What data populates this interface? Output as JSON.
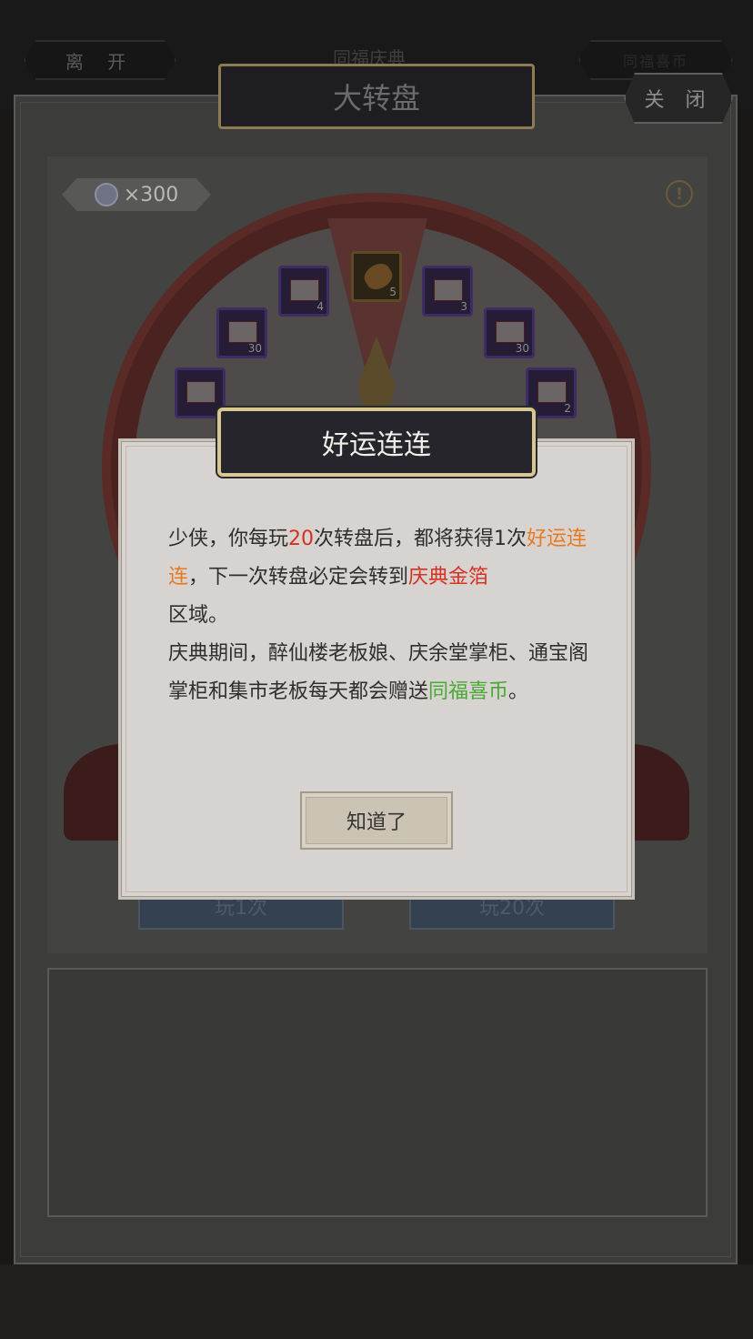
{
  "topbar": {
    "leave_label": "离 开",
    "event_title": "同福庆典",
    "right_label": "同福喜币"
  },
  "header": {
    "title": "大转盘",
    "close_label": "关 闭"
  },
  "wheel": {
    "coin_count": "×300",
    "info_symbol": "!",
    "prizes": [
      {
        "count": "4"
      },
      {
        "count": "5"
      },
      {
        "count": "3"
      },
      {
        "count": "30"
      },
      {
        "count": "30"
      },
      {
        "count": ""
      },
      {
        "count": "2"
      }
    ],
    "play_once_label": "玩1次",
    "play_twenty_label": "玩20次"
  },
  "modal": {
    "title": "好运连连",
    "p1_a": "少侠，你每玩",
    "p1_b": "20",
    "p1_c": "次转盘后，都将获得1次",
    "p1_d": "好运连连",
    "p1_e": "，下一次转盘必定会转到",
    "p1_f": "庆典金箔",
    "p1_g": "区域。",
    "p2_a": "庆典期间，醉仙楼老板娘、庆余堂掌柜、通宝阁掌柜和集市老板每天都会赠送",
    "p2_b": "同福喜币",
    "p2_c": "。",
    "ok_label": "知道了"
  },
  "colors": {
    "highlight_orange": "#e87a1e",
    "highlight_red": "#d7301f",
    "highlight_green": "#4aa834"
  }
}
